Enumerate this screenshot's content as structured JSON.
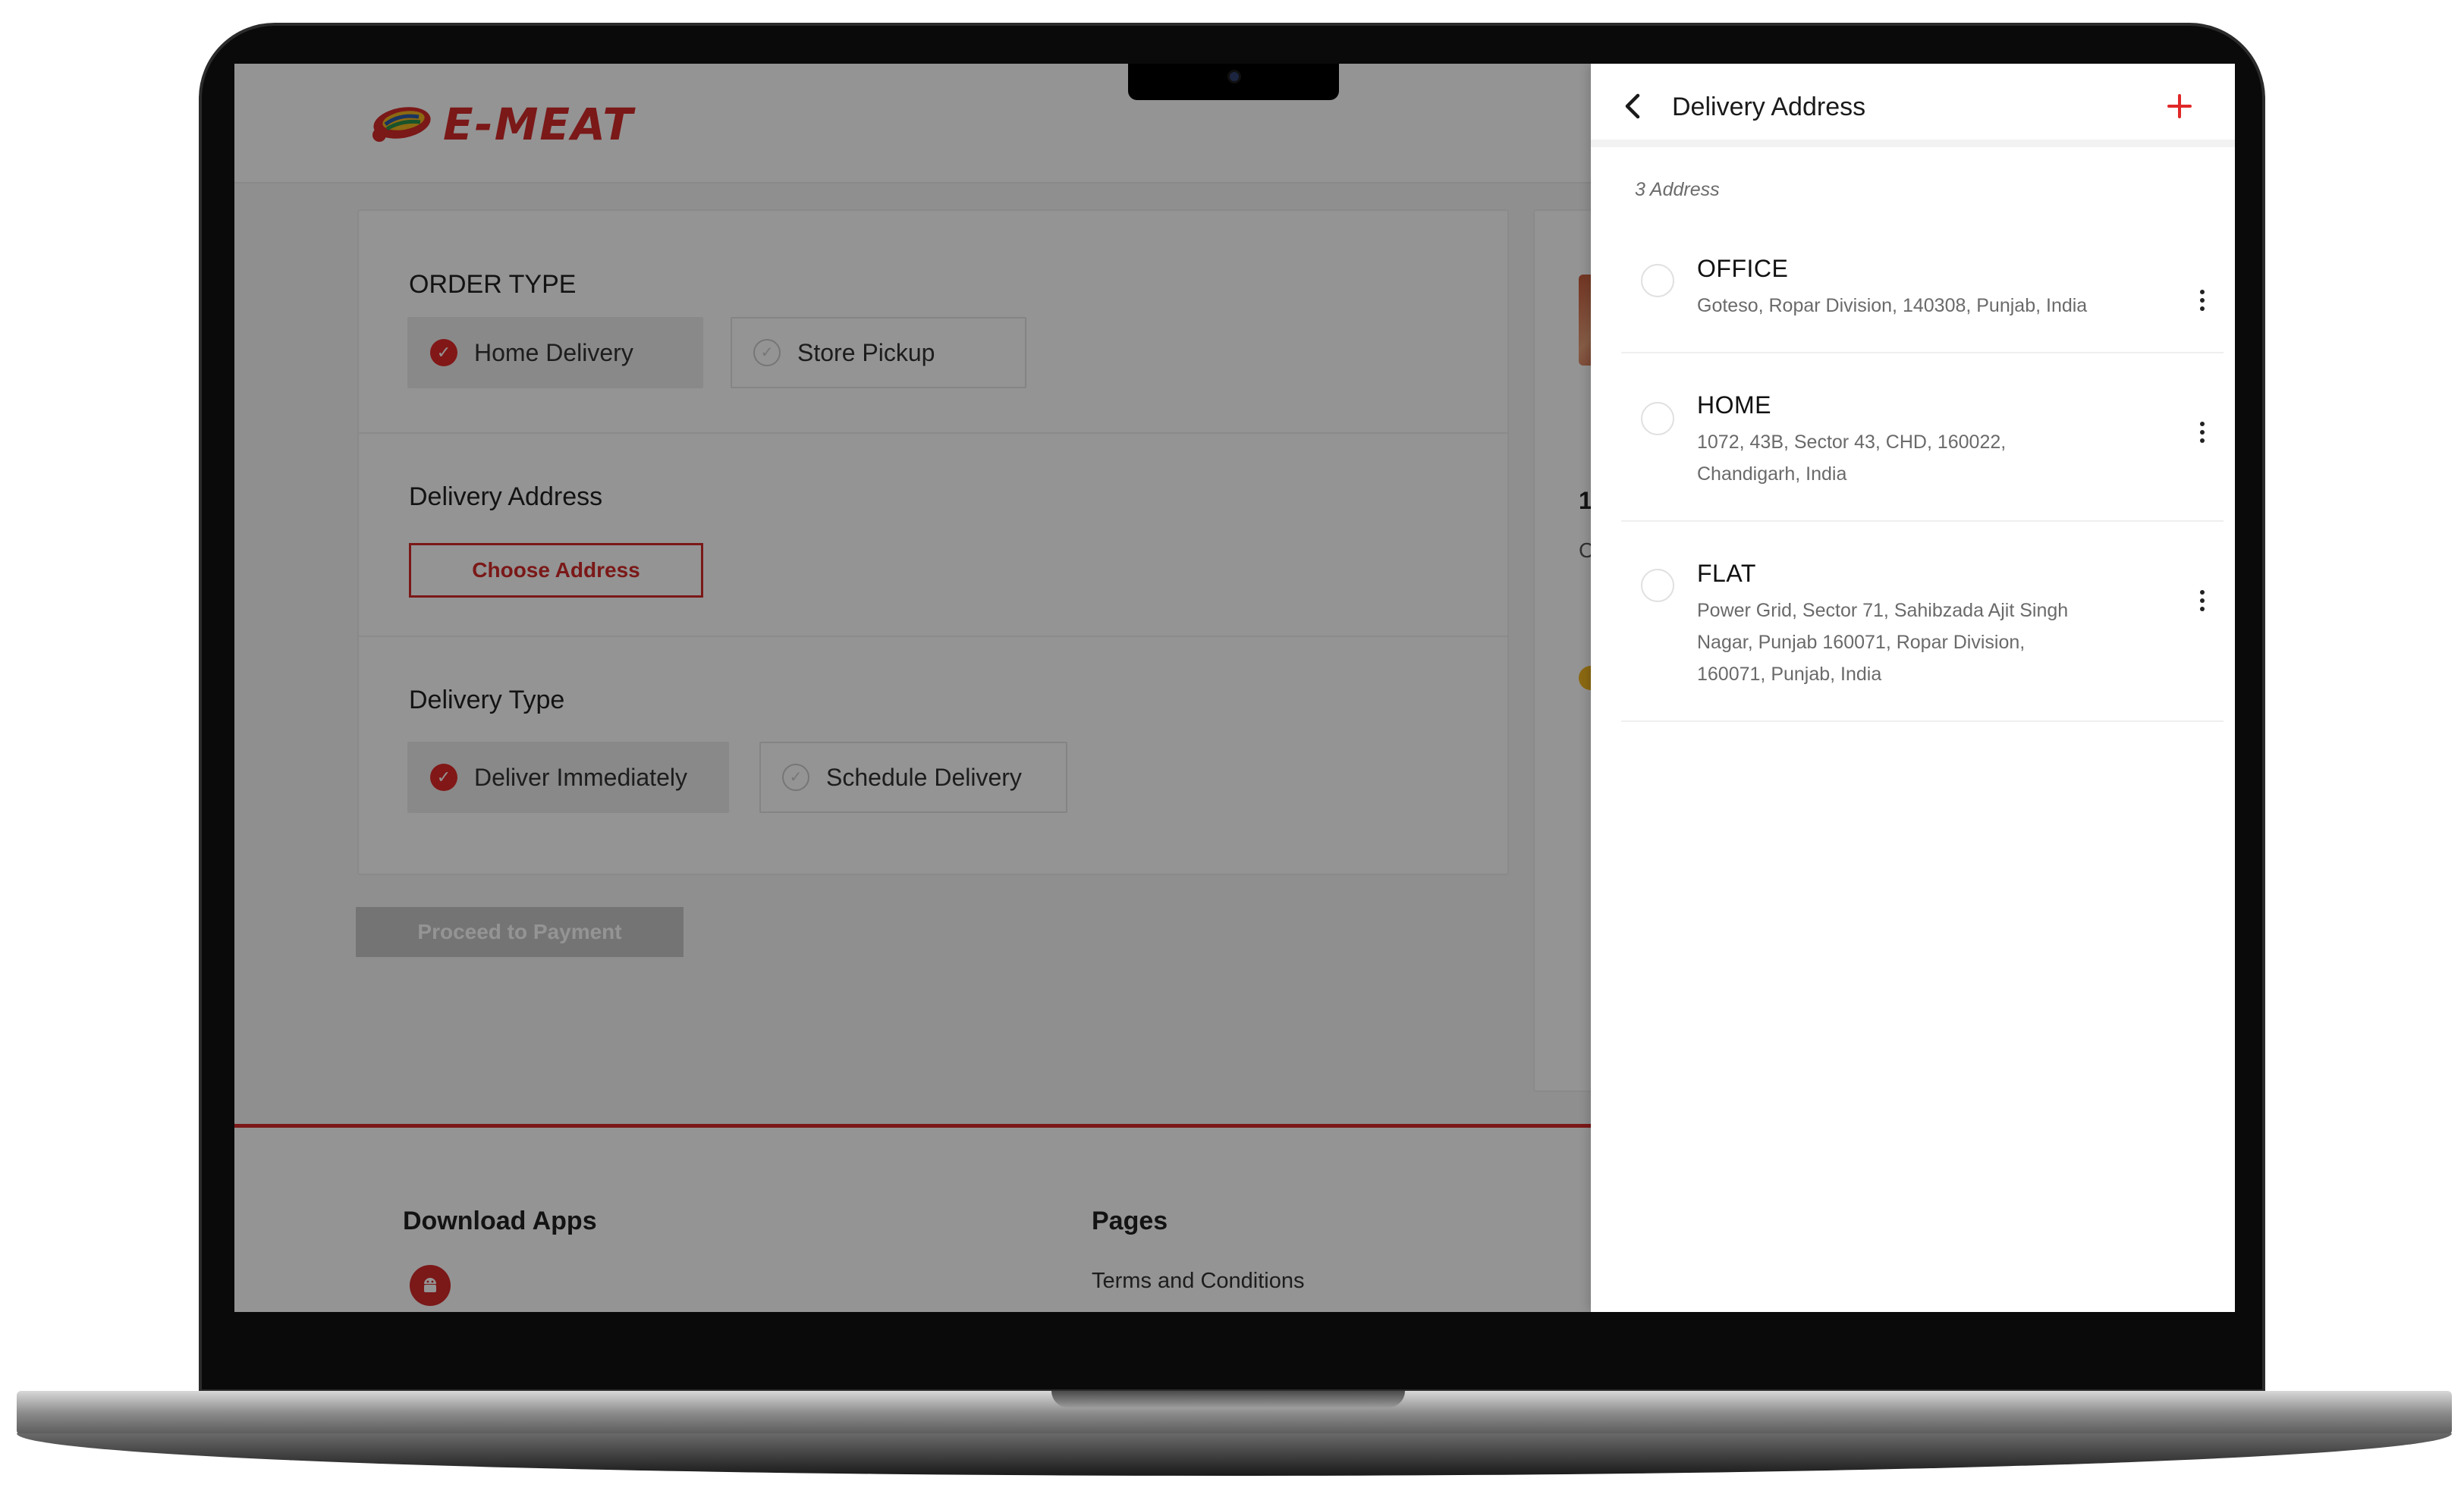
{
  "brand": {
    "name": "E-MEAT",
    "color": "#d42a2a"
  },
  "order_type": {
    "title": "ORDER TYPE",
    "options": [
      {
        "label": "Home Delivery",
        "selected": true
      },
      {
        "label": "Store Pickup",
        "selected": false
      }
    ]
  },
  "delivery_address": {
    "title": "Delivery Address",
    "choose_label": "Choose Address"
  },
  "delivery_type": {
    "title": "Delivery Type",
    "options": [
      {
        "label": "Deliver Immediately",
        "selected": true
      },
      {
        "label": "Schedule Delivery",
        "selected": false
      }
    ]
  },
  "proceed_label": "Proceed to Payment",
  "side_panel": {
    "fragment_1": "1",
    "fragment_2": "C"
  },
  "footer": {
    "download_title": "Download Apps",
    "pages_title": "Pages",
    "terms_link": "Terms and Conditions"
  },
  "drawer": {
    "title": "Delivery Address",
    "count_text": "3 Address",
    "addresses": [
      {
        "label": "OFFICE",
        "lines": [
          "Goteso, Ropar Division, 140308, Punjab, India"
        ]
      },
      {
        "label": "HOME",
        "lines": [
          "1072, 43B, Sector 43, CHD, 160022,",
          "Chandigarh, India"
        ]
      },
      {
        "label": "FLAT",
        "lines": [
          "Power Grid, Sector 71, Sahibzada Ajit Singh",
          "Nagar, Punjab 160071, Ropar Division,",
          "160071, Punjab, India"
        ]
      }
    ]
  },
  "icons": {
    "back": "chevron-left-icon",
    "add": "plus-icon",
    "more": "kebab-menu-icon",
    "check": "check-circle-icon",
    "android": "android-icon"
  },
  "colors": {
    "accent": "#e02828",
    "overlay": "rgba(0,0,0,0.42)"
  }
}
